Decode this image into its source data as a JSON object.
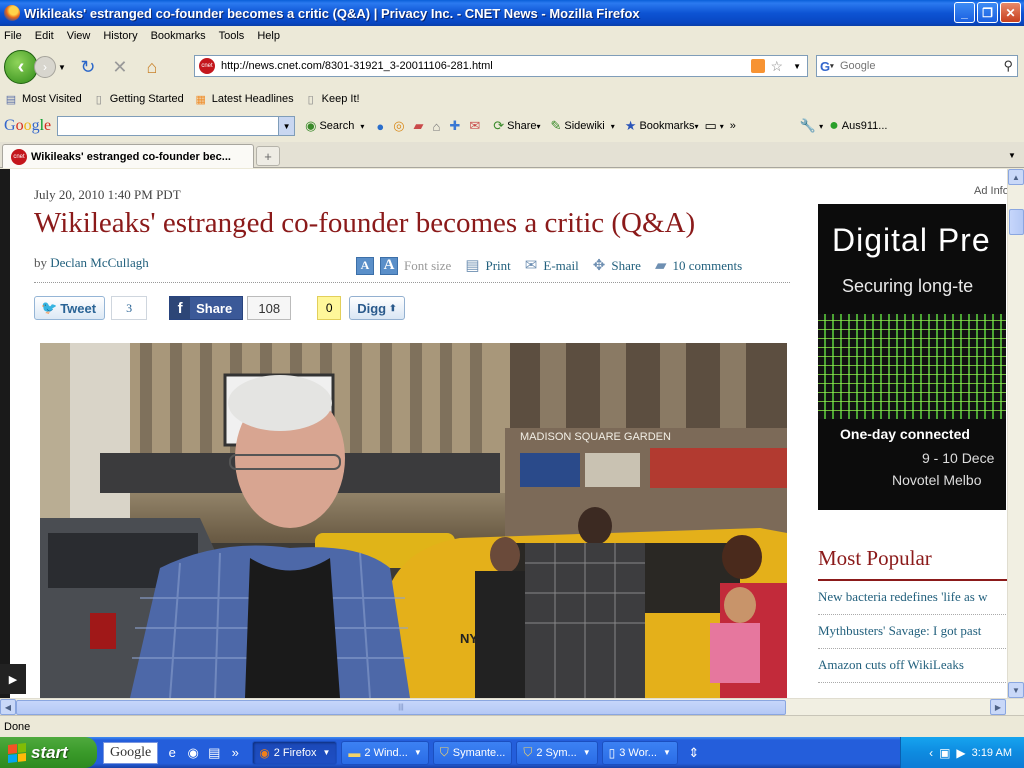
{
  "window": {
    "title": "Wikileaks' estranged co-founder becomes a critic (Q&A) | Privacy Inc. - CNET News - Mozilla Firefox",
    "minimize": "_",
    "restore": "❐",
    "close": "✕"
  },
  "menu": [
    "File",
    "Edit",
    "View",
    "History",
    "Bookmarks",
    "Tools",
    "Help"
  ],
  "nav": {
    "url": "http://news.cnet.com/8301-31921_3-20011106-281.html",
    "site_icon": "cnet",
    "search_placeholder": "Google"
  },
  "bookmarks": [
    "Most Visited",
    "Getting Started",
    "Latest Headlines",
    "Keep It!"
  ],
  "google_toolbar": {
    "logo": [
      "G",
      "o",
      "o",
      "g",
      "l",
      "e"
    ],
    "search_label": "Search",
    "share_label": "Share",
    "sidewiki_label": "Sidewiki",
    "bookmarks_label": "Bookmarks",
    "more": "»",
    "account": "Aus911..."
  },
  "tab": {
    "label": "Wikileaks' estranged co-founder bec...",
    "new_tab": "+"
  },
  "article": {
    "dateline": "July 20, 2010 1:40 PM PDT",
    "headline": "Wikileaks' estranged co-founder becomes a critic (Q&A)",
    "by": "by",
    "author": "Declan McCullagh",
    "font_size_small": "A",
    "font_size_large": "A",
    "font_size_label": "Font size",
    "print": "Print",
    "email": "E-mail",
    "share": "Share",
    "comments": "10 comments"
  },
  "social": {
    "tweet_label": "Tweet",
    "tweet_count": "3",
    "fb_label": "Share",
    "fb_count": "108",
    "digg_count": "0",
    "digg_label": "Digg"
  },
  "photo": {
    "sign_main": "MADISON SQUARE GARDEN",
    "sign_small": "MADISON SQUARE GARDEN",
    "taxi_text": "NYC"
  },
  "ad": {
    "info": "Ad Info",
    "line1": "Digital Pre",
    "line2": "Securing long-te",
    "line3": "One-day connected",
    "line4": "9 - 10 Dece",
    "line5": "Novotel Melbo"
  },
  "popular": {
    "heading": "Most Popular",
    "items": [
      "New bacteria redefines 'life as w",
      "Mythbusters' Savage: I got past",
      "Amazon cuts off WikiLeaks"
    ]
  },
  "status": "Done",
  "taskbar": {
    "start": "start",
    "google": "Google",
    "items": [
      {
        "label": "2 Firefox",
        "active": true
      },
      {
        "label": "2 Wind...",
        "active": false
      },
      {
        "label": "Symante...",
        "active": false
      },
      {
        "label": "2 Sym...",
        "active": false
      },
      {
        "label": "3 Wor...",
        "active": false
      }
    ],
    "clock": "3:19 AM"
  },
  "colors": {
    "headline": "#8b1a1a",
    "link": "#22607d",
    "xp_blue": "#245edb",
    "start_green": "#3a9a2a"
  }
}
